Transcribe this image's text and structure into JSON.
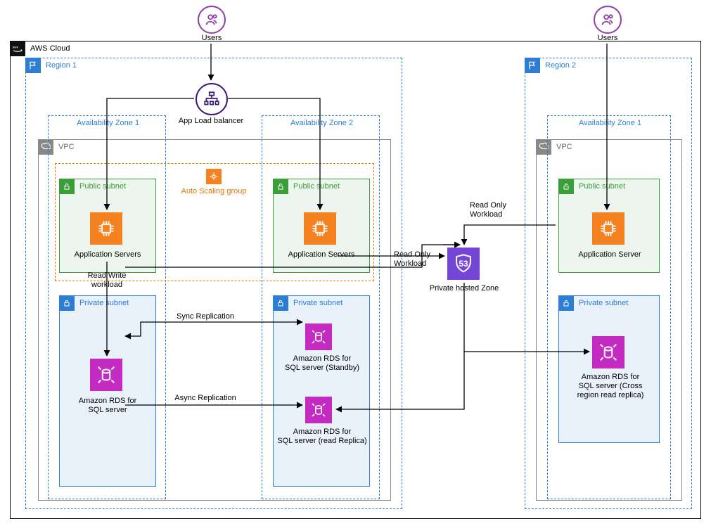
{
  "users": {
    "label": "Users"
  },
  "cloud": {
    "label": "AWS Cloud"
  },
  "region1": {
    "label": "Region 1"
  },
  "region2": {
    "label": "Region 2"
  },
  "vpc": {
    "label": "VPC"
  },
  "az1": {
    "label": "Availability Zone 1"
  },
  "az2": {
    "label": "Availability Zone 2"
  },
  "elb": {
    "label": "App Load balancer"
  },
  "asg": {
    "label": "Auto Scaling group"
  },
  "publicSubnet": {
    "label": "Public subnet"
  },
  "privateSubnet": {
    "label": "Private subnet"
  },
  "appServers": {
    "label": "Application Servers"
  },
  "appServer": {
    "label": "Application Server"
  },
  "rdsPrimary": {
    "line1": "Amazon RDS for",
    "line2": "SQL server"
  },
  "rdsStandby": {
    "line1": "Amazon RDS for",
    "line2": "SQL server (Standby)"
  },
  "rdsReadReplica": {
    "line1": "Amazon RDS for",
    "line2": "SQL server (read Replica)"
  },
  "rdsCrossRegion": {
    "line1": "Amazon RDS for",
    "line2": "SQL server (Cross",
    "line3": "region read replica)"
  },
  "route53": {
    "label": "Private hosted Zone",
    "badge": "53"
  },
  "edges": {
    "syncReplication": "Sync Replication",
    "asyncReplication": "Async Replication",
    "readWriteWorkload": "Read Write workload",
    "readOnlyWorkload": "Read Only Workload"
  }
}
